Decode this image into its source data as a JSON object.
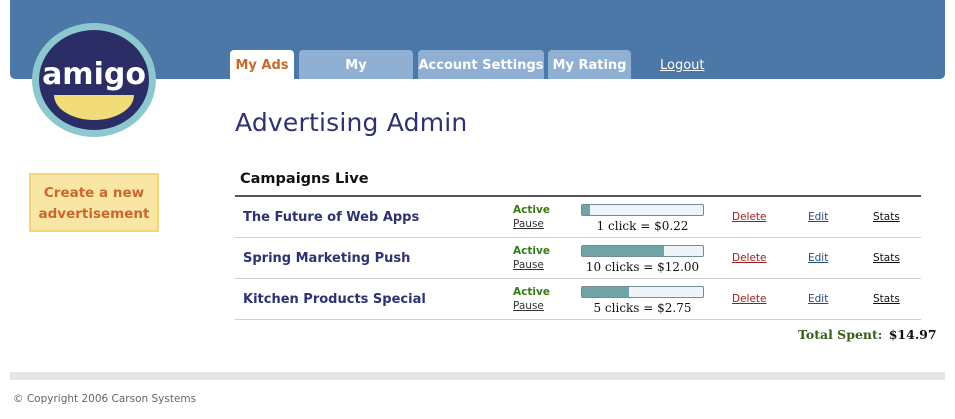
{
  "brand": {
    "logo_text": "amigo",
    "colors": {
      "header": "#4b78a6",
      "tab": "#8fb0d3",
      "accent": "#c8682d",
      "title": "#2e3370",
      "active_status": "#357a14"
    }
  },
  "nav": {
    "tabs": [
      {
        "label": "My Ads",
        "active": true
      },
      {
        "label": "My Newsletters",
        "active": false
      },
      {
        "label": "Account Settings",
        "active": false
      },
      {
        "label": "My Rating",
        "active": false
      }
    ],
    "logout_label": "Logout"
  },
  "sidebar": {
    "create_label": "Create a new advertisement"
  },
  "main": {
    "title": "Advertising Admin",
    "section_title": "Campaigns Live",
    "campaigns": [
      {
        "name": "The Future of Web Apps",
        "status": "Active",
        "pause_label": "Pause",
        "progress": 0.07,
        "clicks_text": "1 click = $0.22",
        "delete_label": "Delete",
        "edit_label": "Edit",
        "stats_label": "Stats"
      },
      {
        "name": "Spring Marketing Push",
        "status": "Active",
        "pause_label": "Pause",
        "progress": 0.68,
        "clicks_text": "10 clicks = $12.00",
        "delete_label": "Delete",
        "edit_label": "Edit",
        "stats_label": "Stats"
      },
      {
        "name": "Kitchen Products Special",
        "status": "Active",
        "pause_label": "Pause",
        "progress": 0.39,
        "clicks_text": "5 clicks = $2.75",
        "delete_label": "Delete",
        "edit_label": "Edit",
        "stats_label": "Stats"
      }
    ],
    "total_label": "Total Spent:",
    "total_value": "$14.97"
  },
  "footer": {
    "copyright": "© Copyright 2006 Carson Systems"
  }
}
